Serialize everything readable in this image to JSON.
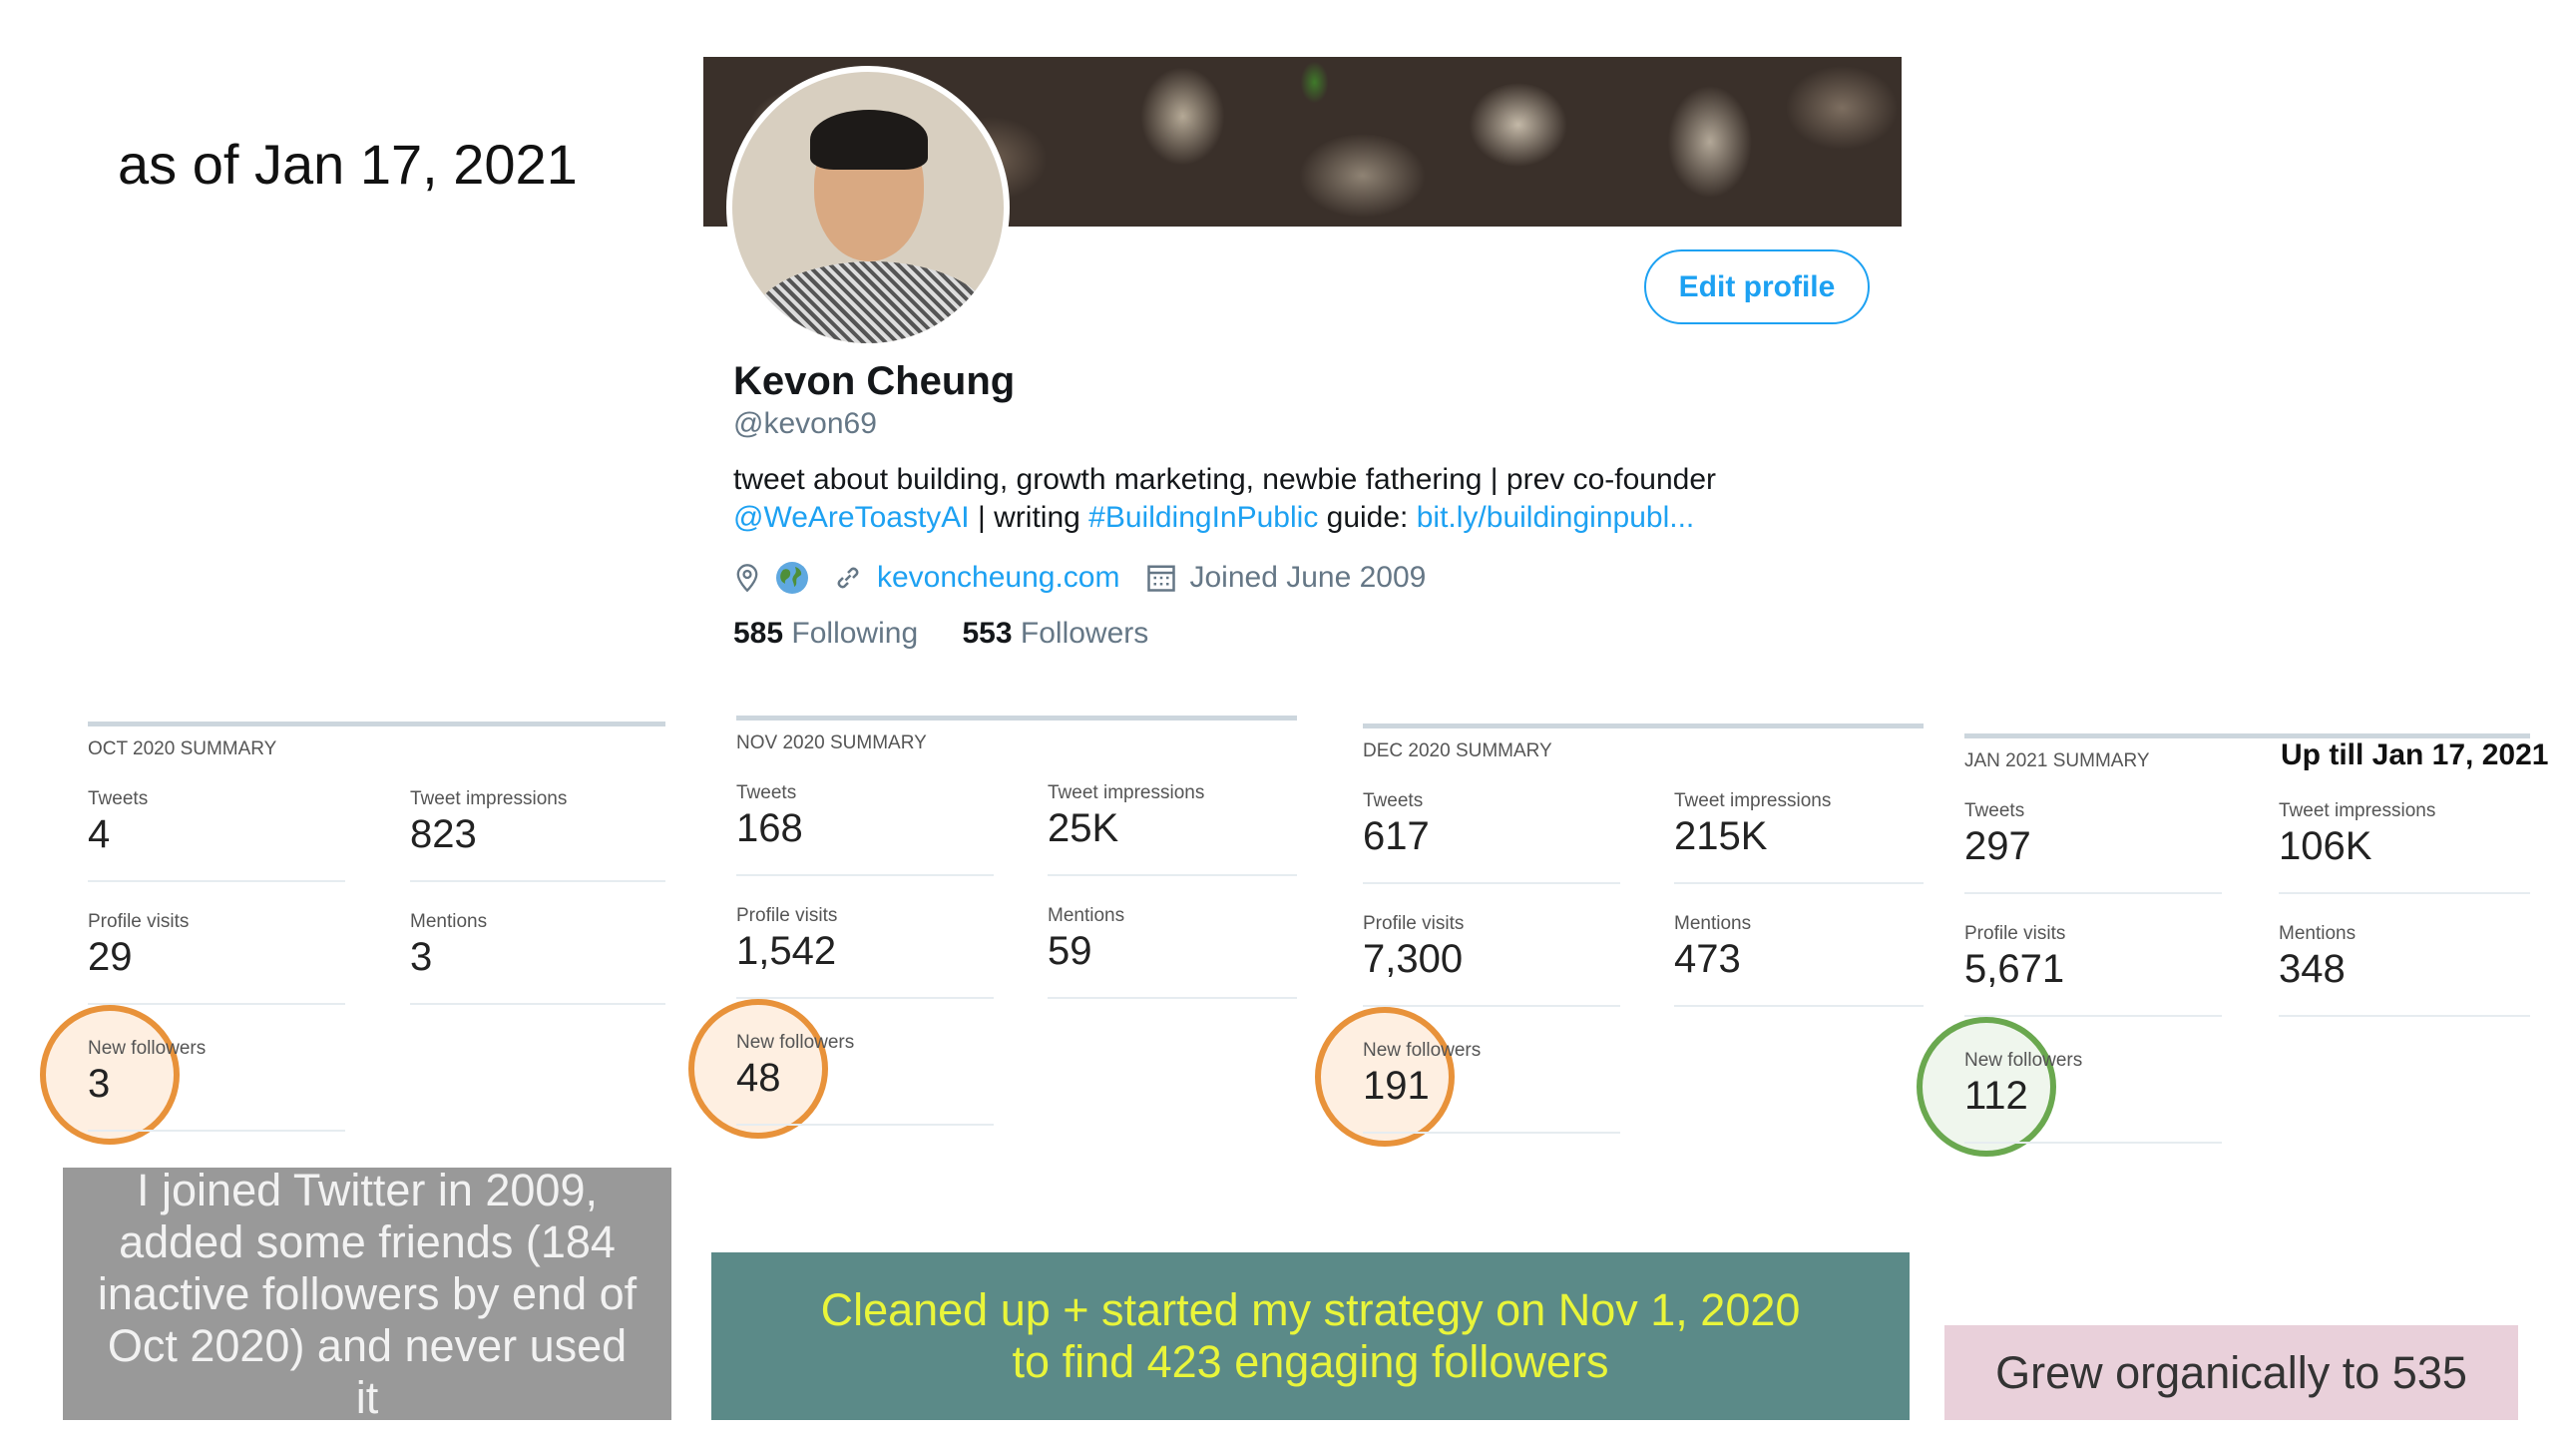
{
  "caption": "as of Jan 17, 2021",
  "profile": {
    "name": "Kevon Cheung",
    "handle": "@kevon69",
    "edit_button": "Edit profile",
    "bio_line1": "tweet about building, growth marketing, newbie fathering | prev co-founder",
    "bio_mention": "@WeAreToastyAI",
    "bio_mid": " | writing ",
    "bio_hashtag": "#BuildingInPublic",
    "bio_guide": " guide: ",
    "bio_link": "bit.ly/buildinginpubl...",
    "website": "kevoncheung.com",
    "joined": "Joined June 2009",
    "following_count": "585",
    "following_label": "Following",
    "followers_count": "553",
    "followers_label": "Followers",
    "icons": [
      "location-icon",
      "globe-icon",
      "link-icon",
      "calendar-icon"
    ]
  },
  "summaries": [
    {
      "title": "OCT 2020 SUMMARY",
      "tweets_label": "Tweets",
      "tweets": "4",
      "impressions_label": "Tweet impressions",
      "impressions": "823",
      "visits_label": "Profile visits",
      "visits": "29",
      "mentions_label": "Mentions",
      "mentions": "3",
      "followers_label": "New followers",
      "followers": "3"
    },
    {
      "title": "NOV 2020 SUMMARY",
      "tweets_label": "Tweets",
      "tweets": "168",
      "impressions_label": "Tweet impressions",
      "impressions": "25K",
      "visits_label": "Profile visits",
      "visits": "1,542",
      "mentions_label": "Mentions",
      "mentions": "59",
      "followers_label": "New followers",
      "followers": "48"
    },
    {
      "title": "DEC 2020 SUMMARY",
      "tweets_label": "Tweets",
      "tweets": "617",
      "impressions_label": "Tweet impressions",
      "impressions": "215K",
      "visits_label": "Profile visits",
      "visits": "7,300",
      "mentions_label": "Mentions",
      "mentions": "473",
      "followers_label": "New followers",
      "followers": "191"
    },
    {
      "title": "JAN 2021 SUMMARY",
      "tweets_label": "Tweets",
      "tweets": "297",
      "impressions_label": "Tweet impressions",
      "impressions": "106K",
      "visits_label": "Profile visits",
      "visits": "5,671",
      "mentions_label": "Mentions",
      "mentions": "348",
      "followers_label": "New followers",
      "followers": "112"
    }
  ],
  "jan_note": "Up till Jan 17, 2021",
  "notes": {
    "gray": "I joined Twitter in 2009, added some friends (184 inactive followers by end of Oct 2020) and never used it",
    "teal_line1": "Cleaned up + started my strategy on Nov 1, 2020",
    "teal_line2": "to find 423 engaging followers",
    "pink": "Grew organically to 535"
  },
  "colors": {
    "twitter_blue": "#1da1f2",
    "highlight_orange": "#e8923a",
    "highlight_green": "#6aa84f",
    "gray_box": "#999999",
    "teal_box": "#5b8a88",
    "teal_text": "#e9f53a",
    "pink_box": "#e9d0da"
  }
}
